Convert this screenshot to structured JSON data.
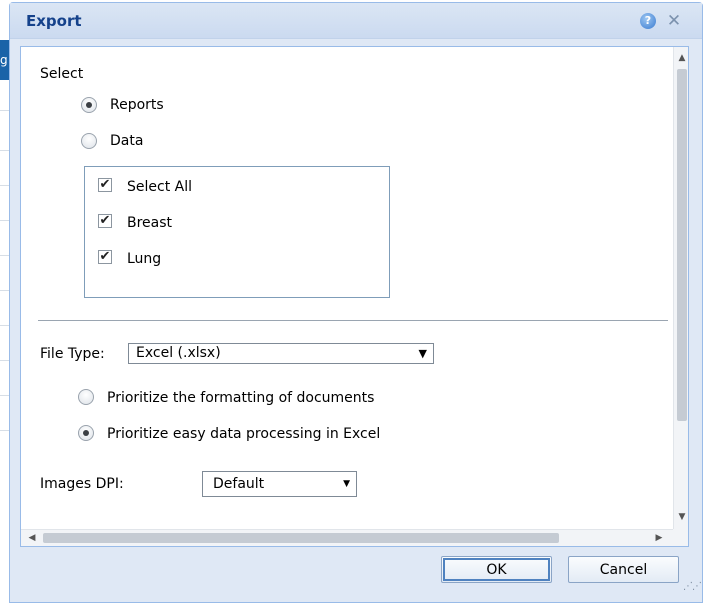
{
  "background_app": {
    "tab_fragment": "g"
  },
  "dialog": {
    "title": "Export",
    "help_glyph": "?",
    "close_glyph": "✕",
    "select_label": "Select",
    "mode_options": [
      {
        "label": "Reports",
        "selected": true
      },
      {
        "label": "Data",
        "selected": false
      }
    ],
    "data_items": [
      {
        "label": "Select All",
        "checked": true
      },
      {
        "label": "Breast",
        "checked": true
      },
      {
        "label": "Lung",
        "checked": true
      }
    ],
    "file_type": {
      "label": "File Type:",
      "value": "Excel (.xlsx)"
    },
    "format_options": [
      {
        "label": "Prioritize the formatting of documents",
        "selected": false
      },
      {
        "label": "Prioritize easy data processing in Excel",
        "selected": true
      }
    ],
    "images_dpi": {
      "label": "Images DPI:",
      "value": "Default"
    },
    "buttons": {
      "ok": "OK",
      "cancel": "Cancel"
    },
    "icons": {
      "help": "help-icon",
      "close": "close-icon",
      "check": "✔",
      "caret": "▼",
      "scroll_up": "▲",
      "scroll_down": "▼",
      "scroll_left": "◀",
      "scroll_right": "▶",
      "resize_grip": "resize-grip-icon"
    },
    "colors": {
      "title_text": "#15428b",
      "frame_border": "#99bbe8",
      "frame_bg": "#dfe8f5",
      "button_border": "#8aa4c6"
    }
  }
}
